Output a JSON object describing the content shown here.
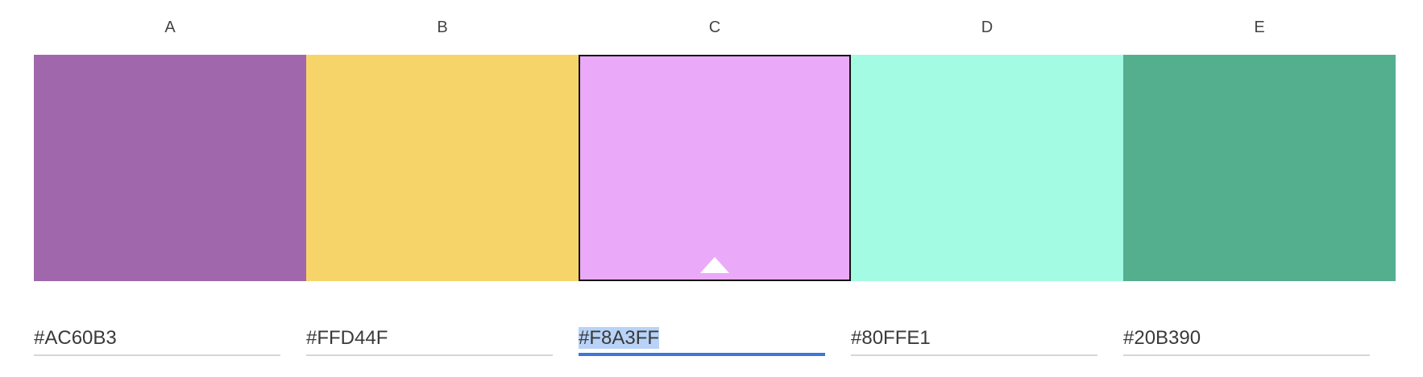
{
  "palette": {
    "columns": [
      {
        "label": "A",
        "hex": "#AC60B3",
        "color": "#A067AD",
        "selected": false
      },
      {
        "label": "B",
        "hex": "#FFD44F",
        "color": "#F7D46A",
        "selected": false
      },
      {
        "label": "C",
        "hex": "#F8A3FF",
        "color": "#EBA9F9",
        "selected": true
      },
      {
        "label": "D",
        "hex": "#80FFE1",
        "color": "#A3FBE3",
        "selected": false
      },
      {
        "label": "E",
        "hex": "#20B390",
        "color": "#54AF8F",
        "selected": false
      }
    ],
    "selected_index": 2,
    "accent_color": "#3b78d8",
    "selection_highlight": "#b8d3f7"
  }
}
